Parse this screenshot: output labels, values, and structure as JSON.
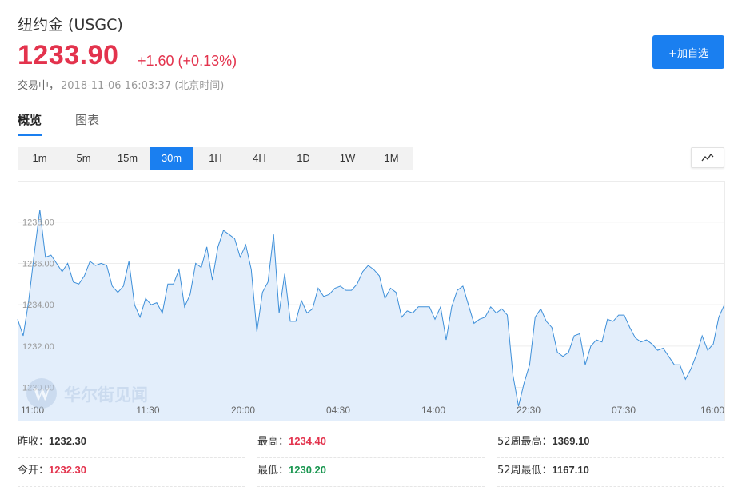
{
  "header": {
    "title": "纽约金 (USGC)",
    "price": "1233.90",
    "change": "+1.60 (+0.13%)",
    "status": "交易中，",
    "time": "2018-11-06 16:03:37 (北京时间)",
    "add_button": "+加自选"
  },
  "tabs": [
    "概览",
    "图表"
  ],
  "periods": {
    "items": [
      "1m",
      "5m",
      "15m",
      "30m",
      "1H",
      "4H",
      "1D",
      "1W",
      "1M"
    ],
    "selected": "30m"
  },
  "chart_toggle_icon": "line-chart-icon",
  "watermark": "华尔街见闻",
  "colors": {
    "up": "#e3334d",
    "down": "#1a9650",
    "accent": "#1a7ff0",
    "area": "#e3eefb",
    "line": "#3d8fd9"
  },
  "stats": [
    {
      "label": "昨收：",
      "value": "1232.30",
      "tone": "dark"
    },
    {
      "label": "最高：",
      "value": "1234.40",
      "tone": "red"
    },
    {
      "label": "52周最高：",
      "value": "1369.10",
      "tone": "dark"
    },
    {
      "label": "今开：",
      "value": "1232.30",
      "tone": "red"
    },
    {
      "label": "最低：",
      "value": "1230.20",
      "tone": "green"
    },
    {
      "label": "52周最低：",
      "value": "1167.10",
      "tone": "dark"
    }
  ],
  "chart_data": {
    "type": "area",
    "x_labels": [
      "11:00",
      "11:30",
      "20:00",
      "04:30",
      "14:00",
      "22:30",
      "07:30",
      "16:00"
    ],
    "y_ticks": [
      "1230.00",
      "1232.00",
      "1234.00",
      "1236.00",
      "1238.00"
    ],
    "ylim": [
      1228.4,
      1240.0
    ],
    "grid": true,
    "values": [
      1233.3,
      1232.5,
      1234.2,
      1236.5,
      1238.6,
      1236.3,
      1236.4,
      1236.0,
      1235.6,
      1236.0,
      1235.1,
      1235.0,
      1235.4,
      1236.1,
      1235.9,
      1236.0,
      1235.9,
      1234.9,
      1234.6,
      1234.9,
      1236.1,
      1234.0,
      1233.4,
      1234.3,
      1234.0,
      1234.1,
      1233.6,
      1235.0,
      1235.0,
      1235.7,
      1233.9,
      1234.5,
      1236.0,
      1235.8,
      1236.8,
      1235.2,
      1236.8,
      1237.6,
      1237.4,
      1237.2,
      1236.3,
      1236.9,
      1235.7,
      1232.7,
      1234.6,
      1235.1,
      1237.4,
      1233.6,
      1235.5,
      1233.2,
      1233.2,
      1234.2,
      1233.6,
      1233.8,
      1234.8,
      1234.4,
      1234.5,
      1234.8,
      1234.9,
      1234.7,
      1234.7,
      1235.0,
      1235.6,
      1235.9,
      1235.7,
      1235.4,
      1234.3,
      1234.8,
      1234.6,
      1233.4,
      1233.7,
      1233.6,
      1233.9,
      1233.9,
      1233.9,
      1233.3,
      1233.9,
      1232.3,
      1233.9,
      1234.7,
      1234.9,
      1234.0,
      1233.1,
      1233.3,
      1233.4,
      1233.9,
      1233.6,
      1233.8,
      1233.5,
      1230.6,
      1229.1,
      1230.2,
      1231.1,
      1233.4,
      1233.8,
      1233.2,
      1232.9,
      1231.7,
      1231.5,
      1231.7,
      1232.5,
      1232.6,
      1231.1,
      1232.0,
      1232.3,
      1232.2,
      1233.3,
      1233.2,
      1233.5,
      1233.5,
      1232.9,
      1232.4,
      1232.2,
      1232.3,
      1232.1,
      1231.8,
      1231.9,
      1231.5,
      1231.1,
      1231.1,
      1230.4,
      1230.9,
      1231.6,
      1232.5,
      1231.8,
      1232.1,
      1233.4,
      1234.0
    ]
  }
}
